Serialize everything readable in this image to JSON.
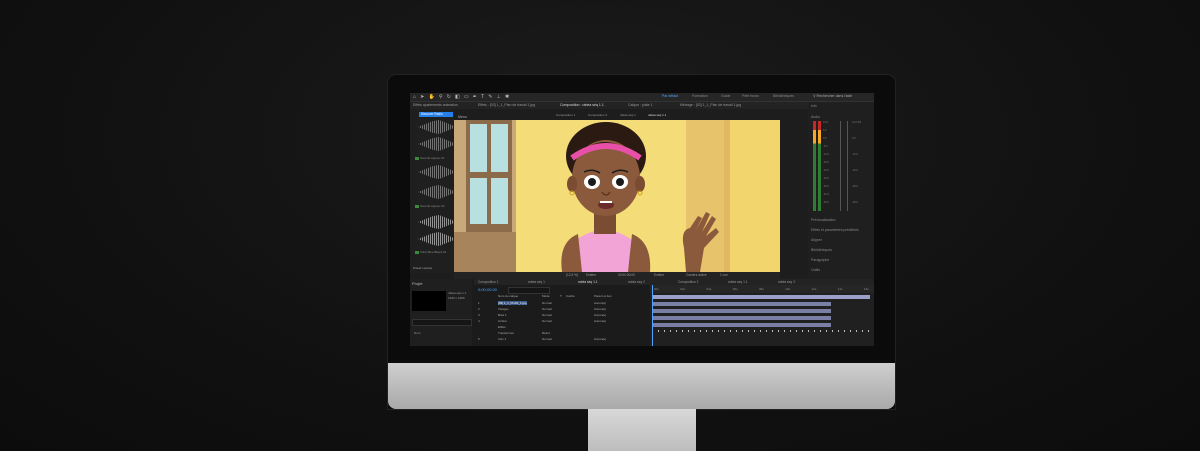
{
  "menubar": {
    "workspaces": [
      "Par défaut",
      "Formation",
      "Guide",
      "Petit écran",
      "Bibliothèques"
    ],
    "active_workspace": "Par défaut",
    "search_label": "Rechercher dans l'aide"
  },
  "tabs": [
    "Effets ajustements animation",
    "Effets : [03] 1_1_Plan de travail 1.jpg",
    "Composition : rabéa séq 1.1",
    "Calque : plate 1",
    "Métrage : [03] 1_1_Plan de travail 1.jpg"
  ],
  "active_tab_index": 2,
  "comp_subtabs": [
    "Composition 1",
    "Composition 2",
    "rabéa séq 1",
    "rabéa séq 1.1"
  ],
  "left_panel": {
    "button_label": "Discover Radio",
    "menu_label": "Menu",
    "audio_items": [
      "Sounds Aperçu 01",
      "Sounds Aperçu 02",
      "Clinic Bee Bleed 01"
    ],
    "footer_label": "Power Lecture"
  },
  "viewer_footer": [
    "(12,5 %)",
    "Entière",
    "00:00:00:00",
    "Entière",
    "Caméra active",
    "1 vue"
  ],
  "right_panel": {
    "title": "Info",
    "audio_label": "Audio",
    "db_left": [
      "12,0",
      "6,0",
      "0,0",
      "-6,0",
      "-12,0",
      "-18,0",
      "-24,0",
      "-30,0",
      "-36,0",
      "-42,0",
      "-48,0"
    ],
    "db_right": [
      "12,0 dB",
      "0,0",
      "-12,0",
      "-24,0",
      "-36,0",
      "-48,0"
    ],
    "sections": [
      "Prévisualisation",
      "Effets et paramètres prédéfinis",
      "Aligner",
      "Bibliothèques",
      "Paragraphe",
      "Outils"
    ]
  },
  "project_panel": {
    "title": "Projet",
    "name_header": "Nom",
    "item_label": "rabéa séq 1.1",
    "sub_label": "1920 x 1080"
  },
  "timeline": {
    "tabs": [
      "Composition 1",
      "rabéa séq 1",
      "rabéa séq 1.1",
      "rabéa seq 2",
      "Composition 2",
      "rabéa seq 1.1",
      "rabéa seq 3"
    ],
    "timecode": "0;00;00;00",
    "columns": [
      "Nom du calque",
      "Mode",
      "T",
      "Cache",
      "Parent et lien"
    ],
    "layers": [
      {
        "num": "1",
        "name": "[03] 1_1_PLAN_1.jpg",
        "mode": "Normal",
        "parent": "Aucun(e)"
      },
      {
        "num": "2",
        "name": "Visages",
        "mode": "Normal",
        "parent": "Aucun(e)"
      },
      {
        "num": "3",
        "name": "Bras 1",
        "mode": "Normal",
        "parent": "Aucun(e)"
      },
      {
        "num": "4",
        "name": "Arrière",
        "mode": "Normal",
        "parent": "Aucun(e)"
      },
      {
        "num": "",
        "name": "Effets",
        "mode": "",
        "parent": ""
      },
      {
        "num": "",
        "name": "Transformer",
        "mode": "Réinit.",
        "parent": ""
      },
      {
        "num": "5",
        "name": "Voix 1",
        "mode": "Normal",
        "parent": "Aucun(e)"
      }
    ],
    "ruler": [
      "00s",
      "02s",
      "04s",
      "06s",
      "08s",
      "10s",
      "12s",
      "14s",
      "16s"
    ],
    "tracks": [
      {
        "start": 0.0,
        "end": 1.0
      },
      {
        "start": 0.0,
        "end": 0.82
      },
      {
        "start": 0.0,
        "end": 0.82
      },
      {
        "start": 0.0,
        "end": 0.82
      },
      {
        "start": 0.0,
        "end": 0.82
      }
    ]
  },
  "colors": {
    "accent": "#2680eb",
    "bg_yellow": "#f4dc78",
    "skin": "#8b5a3c",
    "headband": "#e84fa8",
    "top": "#f2a4d7"
  }
}
